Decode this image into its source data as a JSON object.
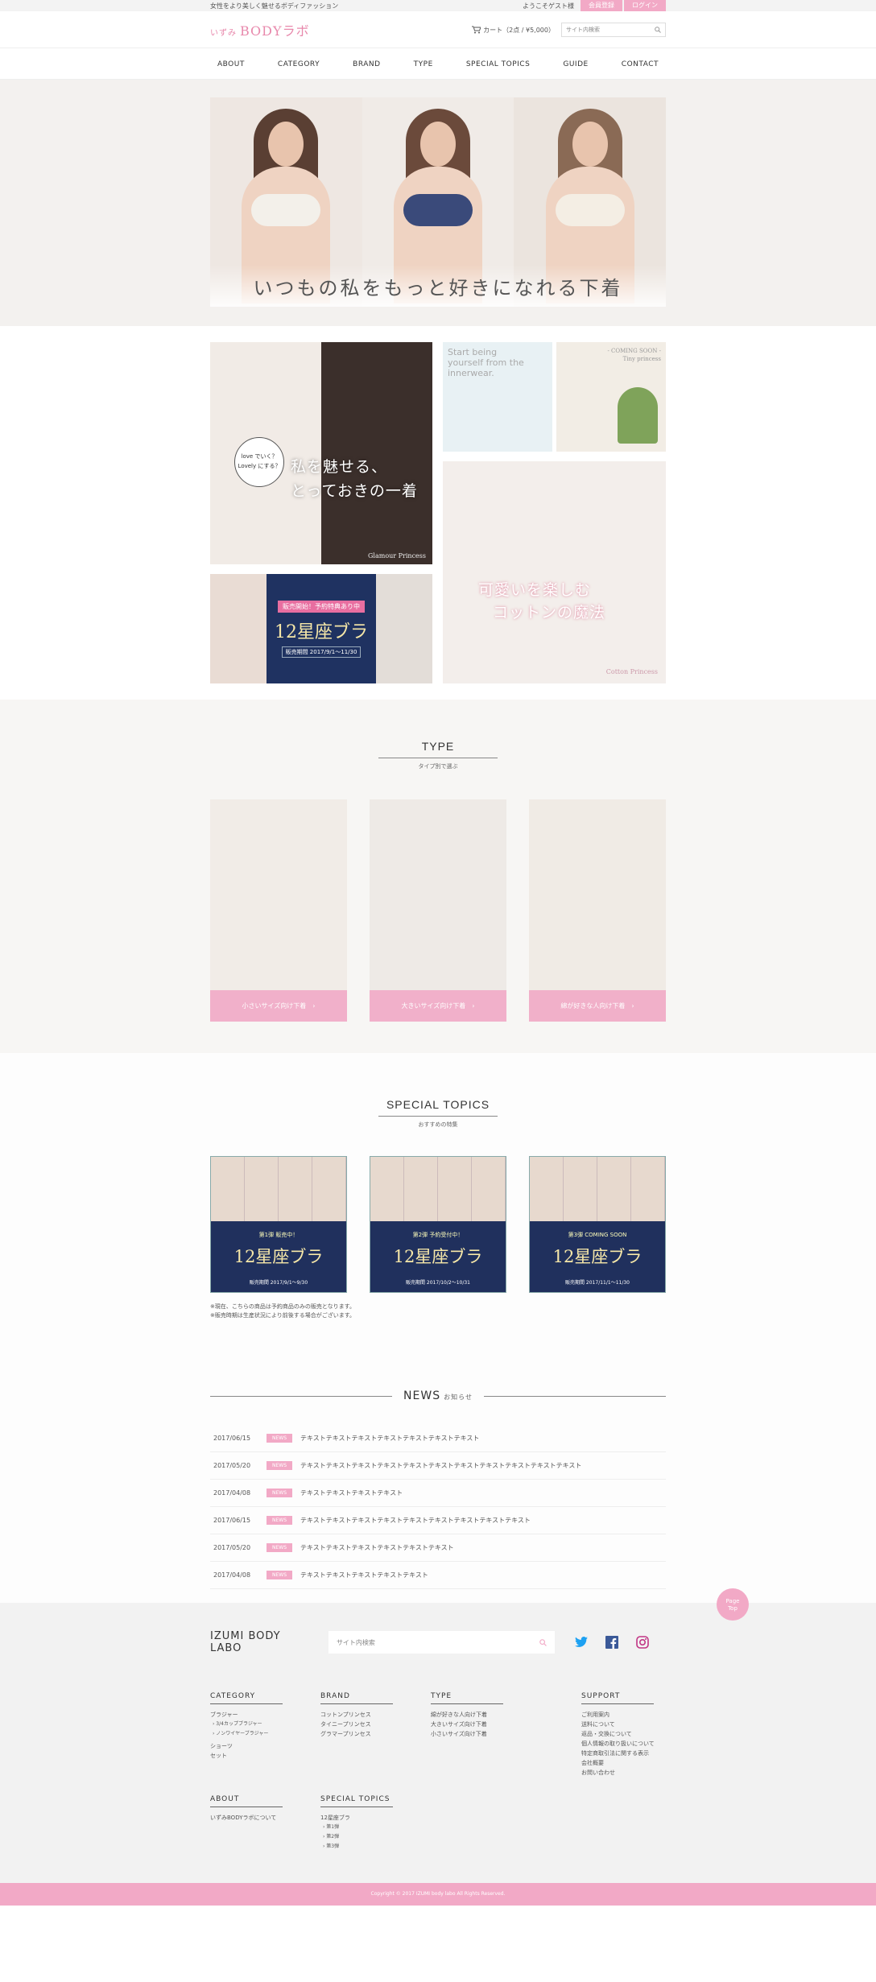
{
  "topbar": {
    "tagline": "女性をより美しく魅せるボディファッション",
    "welcome": "ようこそゲスト様",
    "register": "会員登録",
    "login": "ログイン"
  },
  "header": {
    "logo_small": "いずみ",
    "logo_main": "BODYラボ",
    "cart_text": "カート（2点 / ¥5,000）",
    "search_placeholder": "サイト内検索"
  },
  "nav": [
    "ABOUT",
    "CATEGORY",
    "BRAND",
    "TYPE",
    "SPECIAL TOPICS",
    "GUIDE",
    "CONTACT"
  ],
  "hero": {
    "caption": "いつもの私をもっと好きになれる下着"
  },
  "promo": {
    "t1_bubble": [
      "love でいく？",
      "Lovely にする？"
    ],
    "t1_copy": [
      "私を魅せる、",
      "とっておきの一着"
    ],
    "t1_brand": "Glamour Princess",
    "t2_tag": "販売開始！予約特典あり中",
    "t2_title": "12星座ブラ",
    "t2_date": "販売期間 2017/9/1〜11/30",
    "t3_text": [
      "Start being",
      "yourself from the",
      "innerwear."
    ],
    "t4_text": [
      "- COMING SOON -",
      "Tiny princess"
    ],
    "t5_copy": [
      "可愛いを楽しむ",
      "コットンの魔法"
    ],
    "t5_brand": "Cotton Princess"
  },
  "type_section": {
    "title": "TYPE",
    "subtitle": "タイプ別で選ぶ",
    "cards": [
      {
        "label": "小さいサイズ向け下着　›"
      },
      {
        "label": "大きいサイズ向け下着　›"
      },
      {
        "label": "綿が好きな人向け下着　›"
      }
    ]
  },
  "special": {
    "title": "SPECIAL TOPICS",
    "subtitle": "おすすめの特集",
    "banners": [
      {
        "tag": "第1弾 販売中！",
        "title": "12星座ブラ",
        "date": "販売期間 2017/9/1〜9/30"
      },
      {
        "tag": "第2弾 予約受付中！",
        "title": "12星座ブラ",
        "date": "販売期間 2017/10/2〜10/31"
      },
      {
        "tag": "第3弾 COMING SOON",
        "title": "12星座ブラ",
        "date": "販売期間 2017/11/1〜11/30"
      }
    ],
    "notes": [
      "※現在、こちらの商品は予約商品のみの販売となります。",
      "※販売時期は生産状況により前後する場合がございます。"
    ]
  },
  "news": {
    "title": "NEWS",
    "subtitle": "お知らせ",
    "items": [
      {
        "date": "2017/06/15",
        "badge": "NEWS",
        "text": "テキストテキストテキストテキストテキストテキストテキスト"
      },
      {
        "date": "2017/05/20",
        "badge": "NEWS",
        "text": "テキストテキストテキストテキストテキストテキストテキストテキストテキストテキストテキスト"
      },
      {
        "date": "2017/04/08",
        "badge": "NEWS",
        "text": "テキストテキストテキストテキスト"
      },
      {
        "date": "2017/06/15",
        "badge": "NEWS",
        "text": "テキストテキストテキストテキストテキストテキストテキストテキストテキスト"
      },
      {
        "date": "2017/05/20",
        "badge": "NEWS",
        "text": "テキストテキストテキストテキストテキストテキスト"
      },
      {
        "date": "2017/04/08",
        "badge": "NEWS",
        "text": "テキストテキストテキストテキストテキスト"
      }
    ]
  },
  "footer": {
    "pagetop": [
      "Page",
      "Top"
    ],
    "logo": "IZUMI BODY LABO",
    "search_placeholder": "サイト内検索",
    "category": {
      "title": "CATEGORY",
      "items": [
        "ブラジャー",
        "› 3/4カップブラジャー",
        "› ノンワイヤーブラジャー",
        "ショーツ",
        "セット"
      ]
    },
    "brand": {
      "title": "BRAND",
      "items": [
        "コットンプリンセス",
        "タイニープリンセス",
        "グラマープリンセス"
      ]
    },
    "type": {
      "title": "TYPE",
      "items": [
        "綿が好きな人向け下着",
        "大きいサイズ向け下着",
        "小さいサイズ向け下着"
      ]
    },
    "support": {
      "title": "SUPPORT",
      "items": [
        "ご利用案内",
        "送料について",
        "返品・交換について",
        "個人情報の取り扱いについて",
        "特定商取引法に関する表示",
        "会社概要",
        "お問い合わせ"
      ]
    },
    "about": {
      "title": "ABOUT",
      "items": [
        "いずみBODYラボについて"
      ]
    },
    "special": {
      "title": "SPECIAL TOPICS",
      "items": [
        "12星座ブラ",
        "› 第1弾",
        "› 第2弾",
        "› 第3弾"
      ]
    },
    "copyright": "Copyright © 2017 IZUMI body labo All Rights Reserved."
  }
}
